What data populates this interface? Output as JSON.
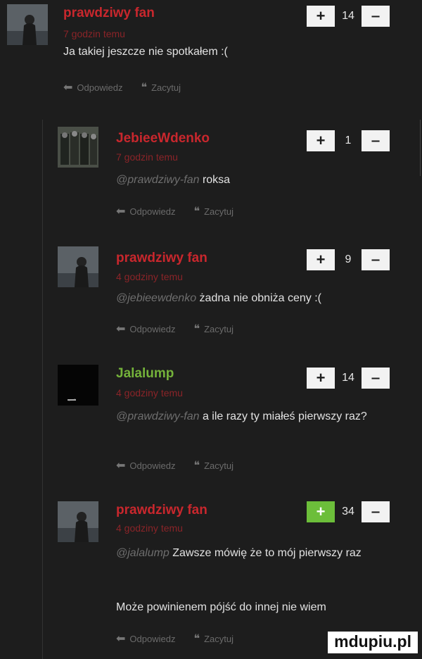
{
  "labels": {
    "reply": "Odpowiedz",
    "quote": "Zacytuj"
  },
  "comments": [
    {
      "author": "prawdziwy fan",
      "time": "7 godzin temu",
      "mention": "",
      "text": "Ja takiej jeszcze nie spotkałem :(",
      "votes": "14",
      "upvote_active": false
    },
    {
      "author": "JebieeWdenko",
      "time": "7 godzin temu",
      "mention": "@prawdziwy-fan",
      "text": "roksa",
      "votes": "1",
      "upvote_active": false
    },
    {
      "author": "prawdziwy fan",
      "time": "4 godziny temu",
      "mention": "@jebieewdenko",
      "text": "żadna nie obniża ceny :(",
      "votes": "9",
      "upvote_active": false
    },
    {
      "author": "Jalalump",
      "time": "4 godziny temu",
      "mention": "@prawdziwy-fan",
      "text": "a ile razy ty miałeś pierwszy raz?",
      "votes": "14",
      "upvote_active": false
    },
    {
      "author": "prawdziwy fan",
      "time": "4 godziny temu",
      "mention": "@jalalump",
      "text": "Zawsze mówię że to mój pierwszy raz",
      "text2": "Może powinienem pójść do innej nie wiem",
      "votes": "34",
      "upvote_active": true
    }
  ],
  "watermark": "mdupiu.pl",
  "colors": {
    "author_red": "#c9272d",
    "author_green": "#74b23a",
    "upvote_active": "#6cbe3a",
    "background": "#1d1d1d"
  }
}
